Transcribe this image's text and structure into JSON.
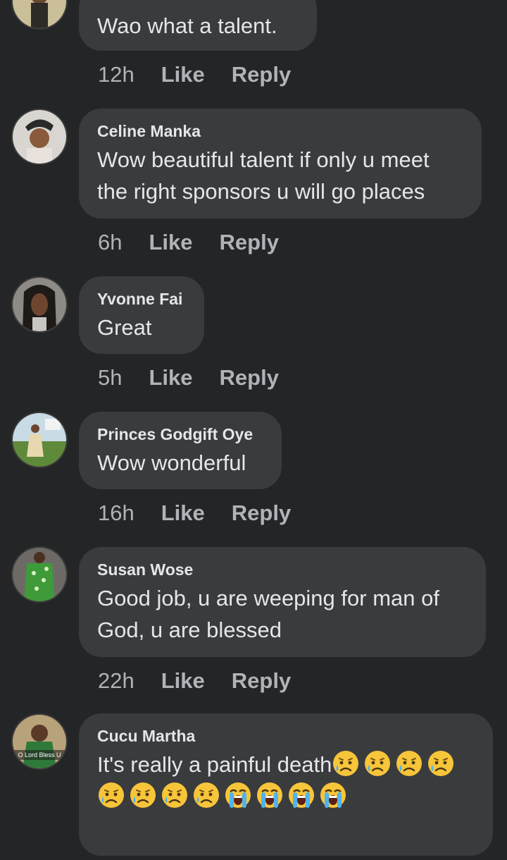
{
  "comments": [
    {
      "author": "",
      "text": "Wao what a talent.",
      "time": "12h",
      "like": "Like",
      "reply": "Reply"
    },
    {
      "author": "Celine Manka",
      "text": "Wow beautiful talent if only u meet the right sponsors u will go places",
      "time": "6h",
      "like": "Like",
      "reply": "Reply"
    },
    {
      "author": "Yvonne Fai",
      "text": "Great",
      "time": "5h",
      "like": "Like",
      "reply": "Reply"
    },
    {
      "author": "Princes Godgift Oye",
      "text": "Wow wonderful",
      "time": "16h",
      "like": "Like",
      "reply": "Reply"
    },
    {
      "author": "Susan Wose",
      "text": "Good job, u are weeping for man of God, u are blessed",
      "time": "22h",
      "like": "Like",
      "reply": "Reply"
    },
    {
      "author": "Cucu Martha",
      "text": "It's really a painful death",
      "time": "",
      "like": "",
      "reply": "",
      "emojis": [
        "sad-tear",
        "sad-tear",
        "sad-tear",
        "sad-tear",
        "sad-tear",
        "sad-tear",
        "sad-tear",
        "sad-tear",
        "crying",
        "crying",
        "crying",
        "crying"
      ],
      "avatar_caption": "O Lord Bless U"
    }
  ],
  "colors": {
    "background": "#242526",
    "bubble": "#3a3b3c",
    "text": "#e4e6eb",
    "meta": "#b0b3b8"
  }
}
